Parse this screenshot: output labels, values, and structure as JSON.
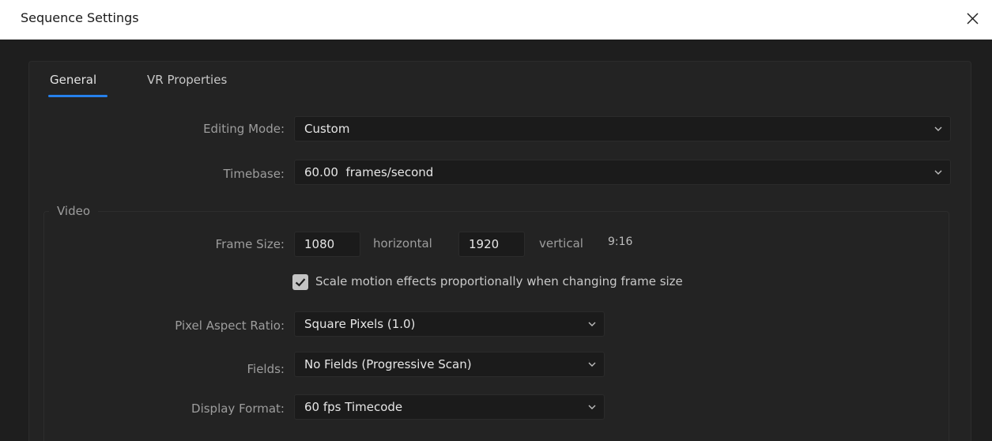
{
  "window": {
    "title": "Sequence Settings"
  },
  "tabs": [
    {
      "label": "General",
      "active": true
    },
    {
      "label": "VR Properties",
      "active": false
    }
  ],
  "general": {
    "editing_mode": {
      "label": "Editing Mode:",
      "value": "Custom"
    },
    "timebase": {
      "label": "Timebase:",
      "value": "60.00  frames/second"
    }
  },
  "video": {
    "legend": "Video",
    "frame_size": {
      "label": "Frame Size:",
      "horizontal_value": "1080",
      "horizontal_label": "horizontal",
      "vertical_value": "1920",
      "vertical_label": "vertical",
      "aspect": "9:16"
    },
    "scale_motion": {
      "label": "Scale motion effects proportionally when changing frame size",
      "checked": true
    },
    "pixel_aspect_ratio": {
      "label": "Pixel Aspect Ratio:",
      "value": "Square Pixels (1.0)"
    },
    "fields": {
      "label": "Fields:",
      "value": "No Fields (Progressive Scan)"
    },
    "display_format": {
      "label": "Display Format:",
      "value": "60 fps Timecode"
    }
  },
  "colors": {
    "accent": "#2680eb",
    "background": "#1e1e1e",
    "panel": "#232323"
  }
}
